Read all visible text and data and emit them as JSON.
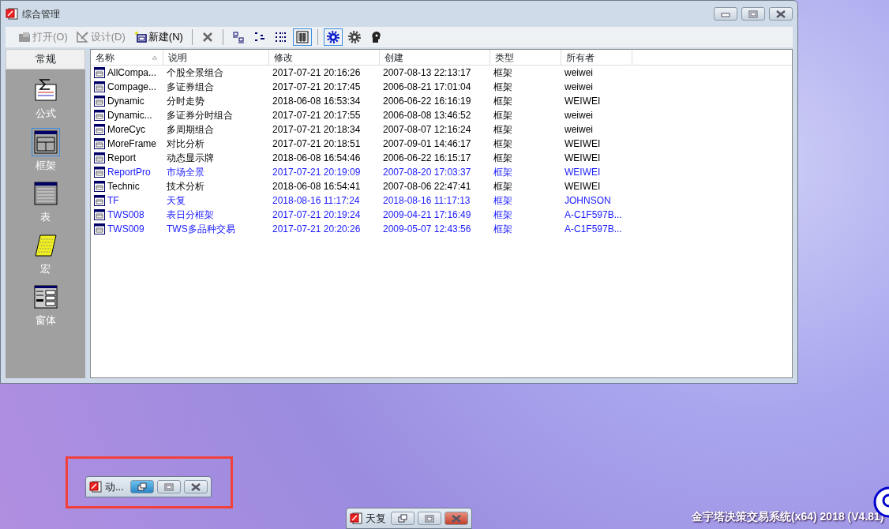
{
  "window": {
    "title": "综合管理"
  },
  "toolbar": [
    {
      "kind": "text",
      "label": "打开(O)",
      "disabled": true
    },
    {
      "kind": "text",
      "label": "设计(D)",
      "disabled": true
    },
    {
      "kind": "text",
      "label": "新建(N)",
      "disabled": false
    },
    {
      "kind": "separator"
    },
    {
      "kind": "icon",
      "selected": false
    },
    {
      "kind": "separator"
    },
    {
      "kind": "icon",
      "selected": false
    },
    {
      "kind": "icon",
      "selected": false
    },
    {
      "kind": "icon",
      "selected": false
    },
    {
      "kind": "icon",
      "selected": true
    },
    {
      "kind": "separator"
    },
    {
      "kind": "icon",
      "selected": true
    },
    {
      "kind": "icon",
      "selected": false
    },
    {
      "kind": "icon",
      "selected": false
    }
  ],
  "sidebar": {
    "header": "常规",
    "items": [
      {
        "label": "公式",
        "selected": false
      },
      {
        "label": "框架",
        "selected": true
      },
      {
        "label": "表",
        "selected": false
      },
      {
        "label": "宏",
        "selected": false
      },
      {
        "label": "窗体",
        "selected": false
      }
    ]
  },
  "table": {
    "columns": [
      {
        "label": "名称",
        "sorted": true
      },
      {
        "label": "说明",
        "sorted": false
      },
      {
        "label": "修改",
        "sorted": false
      },
      {
        "label": "创建",
        "sorted": false
      },
      {
        "label": "类型",
        "sorted": false
      },
      {
        "label": "所有者",
        "sorted": false
      }
    ],
    "rows": [
      {
        "name": "AllCompa...",
        "description": "个股全景组合",
        "modified": "2017-07-21 20:16:26",
        "created": "2007-08-13 22:13:17",
        "type": "框架",
        "owner": "weiwei",
        "highlighted": false
      },
      {
        "name": "Compage...",
        "description": "多证券组合",
        "modified": "2017-07-21 20:17:45",
        "created": "2006-08-21 17:01:04",
        "type": "框架",
        "owner": "weiwei",
        "highlighted": false
      },
      {
        "name": "Dynamic",
        "description": "分时走势",
        "modified": "2018-06-08 16:53:34",
        "created": "2006-06-22 16:16:19",
        "type": "框架",
        "owner": "WEIWEI",
        "highlighted": false
      },
      {
        "name": "Dynamic...",
        "description": "多证券分时组合",
        "modified": "2017-07-21 20:17:55",
        "created": "2006-08-08 13:46:52",
        "type": "框架",
        "owner": "weiwei",
        "highlighted": false
      },
      {
        "name": "MoreCyc",
        "description": "多周期组合",
        "modified": "2017-07-21 20:18:34",
        "created": "2007-08-07 12:16:24",
        "type": "框架",
        "owner": "weiwei",
        "highlighted": false
      },
      {
        "name": "MoreFrame",
        "description": "对比分析",
        "modified": "2017-07-21 20:18:51",
        "created": "2007-09-01 14:46:17",
        "type": "框架",
        "owner": "WEIWEI",
        "highlighted": false
      },
      {
        "name": "Report",
        "description": "动态显示牌",
        "modified": "2018-06-08 16:54:46",
        "created": "2006-06-22 16:15:17",
        "type": "框架",
        "owner": "WEIWEI",
        "highlighted": false
      },
      {
        "name": "ReportPro",
        "description": "市场全景",
        "modified": "2017-07-21 20:19:09",
        "created": "2007-08-20 17:03:37",
        "type": "框架",
        "owner": "WEIWEI",
        "highlighted": true
      },
      {
        "name": "Technic",
        "description": "技术分析",
        "modified": "2018-06-08 16:54:41",
        "created": "2007-08-06 22:47:41",
        "type": "框架",
        "owner": "WEIWEI",
        "highlighted": false
      },
      {
        "name": "TF",
        "description": "天复",
        "modified": "2018-08-16 11:17:24",
        "created": "2018-08-16 11:17:13",
        "type": "框架",
        "owner": "JOHNSON",
        "highlighted": true
      },
      {
        "name": "TWS008",
        "description": "表日分框架",
        "modified": "2017-07-21 20:19:24",
        "created": "2009-04-21 17:16:49",
        "type": "框架",
        "owner": "A-C1F597B...",
        "highlighted": true
      },
      {
        "name": "TWS009",
        "description": "TWS多品种交易",
        "modified": "2017-07-21 20:20:26",
        "created": "2009-05-07 12:43:56",
        "type": "框架",
        "owner": "A-C1F597B...",
        "highlighted": true
      }
    ]
  },
  "minimized_windows": [
    {
      "title": "动...",
      "buttons": [
        {
          "kind": "restore",
          "hovered": true
        },
        {
          "kind": "maximize",
          "hovered": false
        },
        {
          "kind": "close",
          "hovered": false
        }
      ]
    },
    {
      "title": "天复",
      "buttons": [
        {
          "kind": "restore",
          "hovered": false
        },
        {
          "kind": "maximize",
          "hovered": false
        },
        {
          "kind": "close",
          "hovered": true
        }
      ]
    }
  ],
  "annotation": {
    "kind": "rectangle"
  },
  "status_text": "金宇塔决策交易系统(x64) 2018 (V4.81)"
}
